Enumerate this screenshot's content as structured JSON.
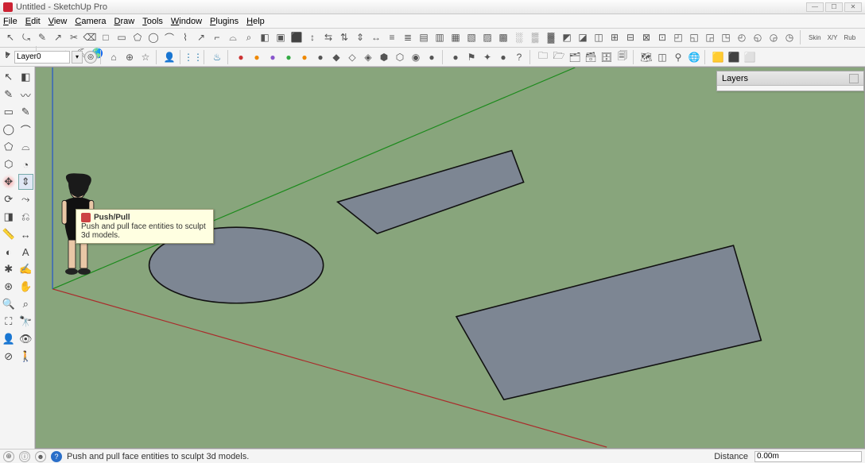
{
  "window": {
    "title": "Untitled - SketchUp Pro",
    "controls": {
      "min": "—",
      "max": "☐",
      "close": "✕"
    }
  },
  "menu": {
    "items": [
      "File",
      "Edit",
      "View",
      "Camera",
      "Draw",
      "Tools",
      "Window",
      "Plugins",
      "Help"
    ]
  },
  "layerInput": {
    "check": "✓",
    "value": "Layer0"
  },
  "topToolbar1": [
    "↖",
    "⤿",
    "✎",
    "↗",
    "✂",
    "⌫",
    "□",
    "▭",
    "⬠",
    "◯",
    "⌒",
    "⌇",
    "↗",
    "⌐",
    "⌓",
    "⌕",
    "◧",
    "▣",
    "⬛",
    "↕",
    "⇆",
    "⇅",
    "⇕",
    "↔",
    "≡",
    "≣",
    "▤",
    "▥",
    "▦",
    "▧",
    "▨",
    "▩",
    "░",
    "▒",
    "▓",
    "◩",
    "◪",
    "◫",
    "⊞",
    "⊟",
    "⊠",
    "⊡",
    "◰",
    "◱",
    "◲",
    "◳",
    "◴",
    "◵",
    "◶",
    "◷"
  ],
  "topToolbar1b": [
    "Skin",
    "X/Y",
    "Rub",
    "▶",
    "■",
    "?"
  ],
  "topToolbar1c": [
    "☁",
    "♣",
    "⛏",
    "🌎"
  ],
  "topToolbar2": [
    "⌂",
    "⊕",
    "☆",
    " ",
    "👤",
    " ",
    "⋮⋮",
    " ",
    "♨",
    " ",
    "●",
    "●",
    "●",
    "●",
    "●",
    "●",
    "◆",
    "◇",
    "◈",
    "⬢",
    "⬡",
    "◉",
    "●",
    " ",
    "●",
    "⚑",
    "✦",
    "●",
    "?",
    " ",
    "🗀",
    "🗁",
    "🗂",
    "🗃",
    "🗄",
    "🗐",
    " ",
    "🗺",
    "◫",
    "⚲",
    "🌐",
    " ",
    "🟨",
    "⬛",
    "⬜"
  ],
  "leftTools": [
    {
      "name": "select-tool",
      "g": "↖"
    },
    {
      "name": "eraser-tool",
      "g": "◧"
    },
    {
      "name": "line-tool",
      "g": "✎"
    },
    {
      "name": "freehand-tool",
      "g": "〰"
    },
    {
      "name": "rectangle-tool",
      "g": "▭"
    },
    {
      "name": "stylus-tool",
      "g": "✎"
    },
    {
      "name": "circle-tool",
      "g": "◯"
    },
    {
      "name": "arc-tool",
      "g": "⌒"
    },
    {
      "name": "polygon-tool",
      "g": "⬠"
    },
    {
      "name": "arc2-tool",
      "g": "⌓"
    },
    {
      "name": "polygon2-tool",
      "g": "⬡"
    },
    {
      "name": "pie-tool",
      "g": "◔"
    },
    {
      "name": "move-tool",
      "g": "✥",
      "highlight": true
    },
    {
      "name": "pushpull-tool",
      "g": "⇕",
      "selected": true
    },
    {
      "name": "rotate-tool",
      "g": "⟳"
    },
    {
      "name": "followme-tool",
      "g": "⤳"
    },
    {
      "name": "scale-tool",
      "g": "◨"
    },
    {
      "name": "offset-tool",
      "g": "⎌"
    },
    {
      "name": "tape-tool",
      "g": "📏"
    },
    {
      "name": "dimension-tool",
      "g": "↔"
    },
    {
      "name": "protractor-tool",
      "g": "◐"
    },
    {
      "name": "text-tool",
      "g": "A"
    },
    {
      "name": "axes-tool",
      "g": "✱"
    },
    {
      "name": "3dtext-tool",
      "g": "✍"
    },
    {
      "name": "orbit-tool",
      "g": "⊛"
    },
    {
      "name": "pan-tool",
      "g": "✋"
    },
    {
      "name": "zoom-tool",
      "g": "🔍"
    },
    {
      "name": "zoom-window-tool",
      "g": "⌕"
    },
    {
      "name": "zoom-extents-tool",
      "g": "⛶"
    },
    {
      "name": "prev-view-tool",
      "g": "🔭"
    },
    {
      "name": "position-camera-tool",
      "g": "👤"
    },
    {
      "name": "look-around-tool",
      "g": "👁"
    },
    {
      "name": "section-tool",
      "g": "⊘"
    },
    {
      "name": "walk-tool",
      "g": "🚶"
    }
  ],
  "tooltip": {
    "title": "Push/Pull",
    "body": "Push and pull face entities to sculpt 3d models."
  },
  "layersPanel": {
    "title": "Layers"
  },
  "statusbar": {
    "msg": "Push and pull face entities to sculpt 3d models.",
    "distLabel": "Distance",
    "distValue": "0.00m"
  }
}
